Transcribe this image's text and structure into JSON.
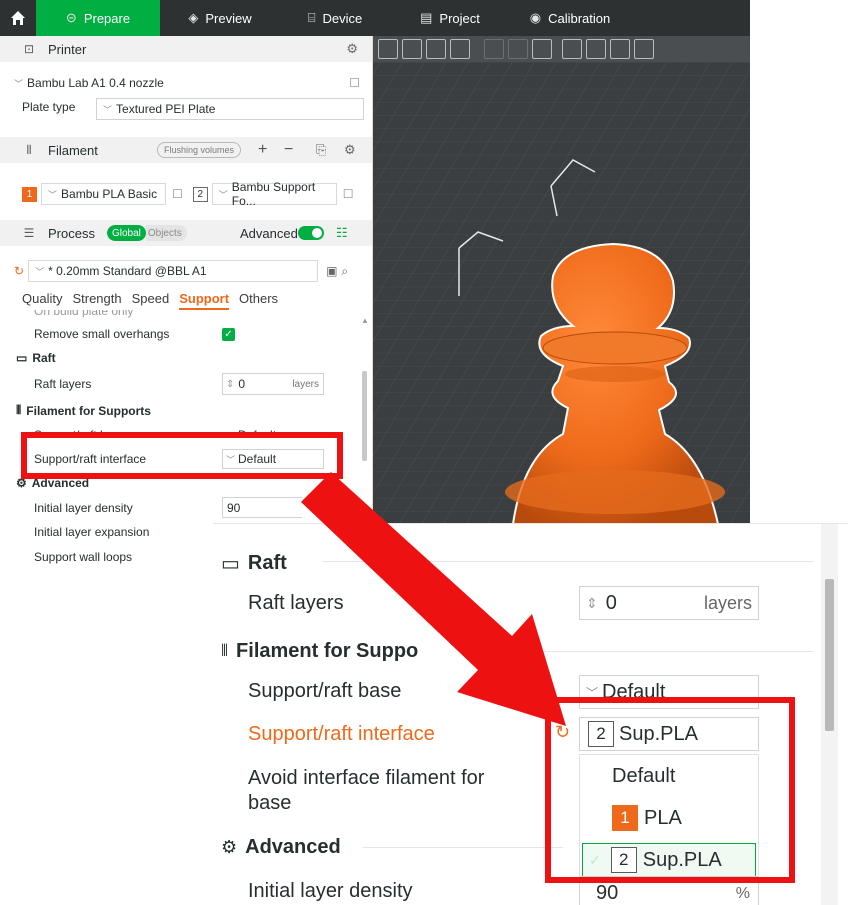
{
  "topbar": {
    "tabs": [
      {
        "label": "Prepare",
        "icon": "prepare-icon"
      },
      {
        "label": "Preview",
        "icon": "preview-icon"
      },
      {
        "label": "Device",
        "icon": "device-icon"
      },
      {
        "label": "Project",
        "icon": "project-icon"
      },
      {
        "label": "Calibration",
        "icon": "calibration-icon"
      }
    ]
  },
  "printer": {
    "section_label": "Printer",
    "name": "Bambu Lab A1 0.4 nozzle",
    "plate_type_label": "Plate type",
    "plate_type_value": "Textured PEI Plate"
  },
  "filament": {
    "section_label": "Filament",
    "flushing_label": "Flushing volumes",
    "slots": [
      {
        "index": "1",
        "name": "Bambu PLA Basic"
      },
      {
        "index": "2",
        "name": "Bambu Support Fo..."
      }
    ]
  },
  "process": {
    "section_label": "Process",
    "global_label": "Global",
    "objects_label": "Objects",
    "advanced_label": "Advanced",
    "profile": "* 0.20mm Standard @BBL A1",
    "tabs": [
      "Quality",
      "Strength",
      "Speed",
      "Support",
      "Others"
    ],
    "active_tab": "Support"
  },
  "support_options": {
    "partial_label": "On build plate only",
    "remove_small_overhangs_label": "Remove small overhangs",
    "raft_title": "Raft",
    "raft_layers_label": "Raft layers",
    "raft_layers_value": "0",
    "raft_layers_unit": "layers",
    "filament_supports_title": "Filament for Supports",
    "support_base_label": "Support/raft base",
    "support_base_value": "Default",
    "support_interface_label": "Support/raft interface",
    "support_interface_value": "Default",
    "advanced_title": "Advanced",
    "initial_layer_density_label": "Initial layer density",
    "initial_layer_density_value": "90",
    "initial_layer_expansion_label": "Initial layer expansion",
    "support_wall_loops_label": "Support wall loops"
  },
  "zoom": {
    "raft_title": "Raft",
    "raft_layers_label": "Raft layers",
    "raft_layers_value": "0",
    "raft_layers_unit": "layers",
    "filament_supports_title": "Filament for Suppo",
    "support_base_label": "Support/raft base",
    "support_base_value": "Default",
    "support_interface_label": "Support/raft interface",
    "support_interface_index": "2",
    "support_interface_value": "Sup.PLA",
    "avoid_interface_label_1": "Avoid interface filament for",
    "avoid_interface_label_2": "base",
    "dropdown_options": [
      {
        "index": "",
        "label": "Default"
      },
      {
        "index": "1",
        "label": "PLA"
      },
      {
        "index": "2",
        "label": "Sup.PLA"
      }
    ],
    "advanced_title": "Advanced",
    "initial_layer_density_label": "Initial layer density",
    "initial_layer_density_value": "90",
    "initial_layer_density_unit": "%"
  },
  "colors": {
    "accent_green": "#00ae42",
    "accent_orange": "#ee6a1a",
    "highlight_red": "#ee1111",
    "pawn_orange": "#ee6a1a"
  }
}
